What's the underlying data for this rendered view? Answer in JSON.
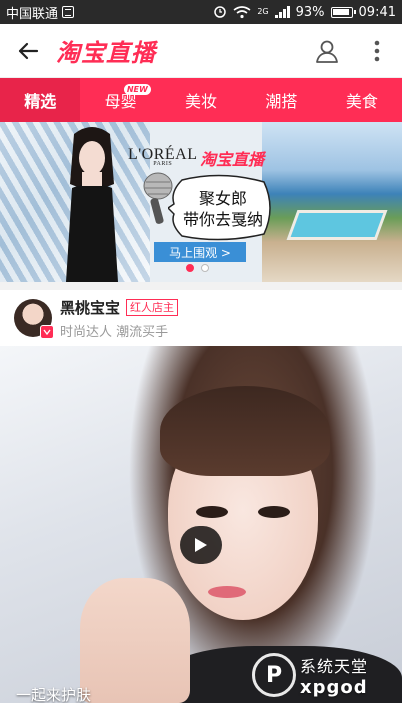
{
  "status_bar": {
    "carrier": "中国联通",
    "network": "2G",
    "battery": "93%",
    "time": "09:41"
  },
  "header": {
    "title": "淘宝直播"
  },
  "tabs": [
    {
      "label": "精选",
      "active": true,
      "badge": ""
    },
    {
      "label": "母婴",
      "active": false,
      "badge": "NEW"
    },
    {
      "label": "美妆",
      "active": false,
      "badge": ""
    },
    {
      "label": "潮搭",
      "active": false,
      "badge": ""
    },
    {
      "label": "美食",
      "active": false,
      "badge": ""
    }
  ],
  "banner": {
    "brand_loreal": "L'ORÉAL",
    "brand_loreal_sub": "PARIS",
    "brand_taobao": "淘宝直播",
    "headline_line1": "聚女郎",
    "headline_line2": "带你去戛纳",
    "cta": "马上围观 >",
    "slide_index": 1,
    "slide_count": 2
  },
  "post": {
    "author_name": "黑桃宝宝",
    "author_tag": "红人店主",
    "author_subtitle": "时尚达人 潮流买手",
    "video_caption": "一起来护肤"
  },
  "watermark": {
    "text_cn": "系统天堂",
    "text_en": "xpgod"
  },
  "colors": {
    "accent": "#ff2d55",
    "status_bar": "#2a2a2a",
    "cta_blue": "#3a8fd6"
  }
}
